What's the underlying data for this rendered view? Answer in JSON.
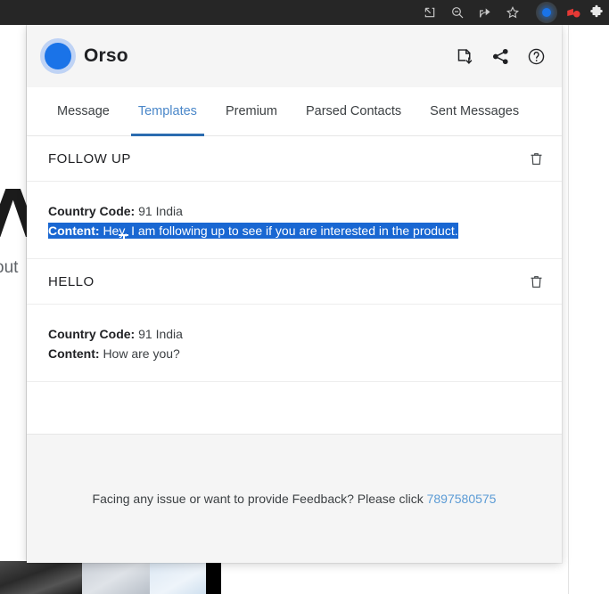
{
  "browser": {
    "icons": [
      {
        "name": "open-in-new-icon",
        "title": "Open in new window"
      },
      {
        "name": "zoom-out-icon",
        "title": "Zoom out"
      },
      {
        "name": "share-icon",
        "title": "Share this page"
      },
      {
        "name": "bookmark-star-icon",
        "title": "Bookmark this tab"
      }
    ],
    "extensions": [
      {
        "name": "orso-extension-icon",
        "color": "#1a73e8"
      },
      {
        "name": "red-extension-icon",
        "color": "#e53935"
      },
      {
        "name": "extensions-puzzle-icon",
        "color": "#e8e8e8"
      }
    ]
  },
  "background": {
    "logo_mark": "Λ",
    "word": "out"
  },
  "popup": {
    "header": {
      "brand_name": "Orso",
      "logo_color": "#1a73e8",
      "actions": [
        {
          "name": "save-file-icon",
          "label": "Download"
        },
        {
          "name": "share-icon",
          "label": "Share"
        },
        {
          "name": "help-circle-icon",
          "label": "Help"
        }
      ]
    },
    "tabs": [
      {
        "label": "Message",
        "active": false
      },
      {
        "label": "Templates",
        "active": true
      },
      {
        "label": "Premium",
        "active": false
      },
      {
        "label": "Parsed Contacts",
        "active": false
      },
      {
        "label": "Sent Messages",
        "active": false
      }
    ],
    "active_tab_color": "#4a87c9",
    "templates": [
      {
        "title": "FOLLOW UP",
        "country_code_label": "Country Code:",
        "country_code_value": "91 India",
        "content_label": "Content:",
        "content_value": "Hey, I am following up to see if you are interested in the product.",
        "selected": true,
        "delete_icon": "trash-icon"
      },
      {
        "title": "HELLO",
        "country_code_label": "Country Code:",
        "country_code_value": "91 India",
        "content_label": "Content:",
        "content_value": "How are you?",
        "selected": false,
        "delete_icon": "trash-icon"
      }
    ],
    "footer": {
      "text": "Facing any issue or want to provide Feedback? Please click ",
      "link": "7897580575",
      "link_color": "#5b9bd5"
    }
  }
}
